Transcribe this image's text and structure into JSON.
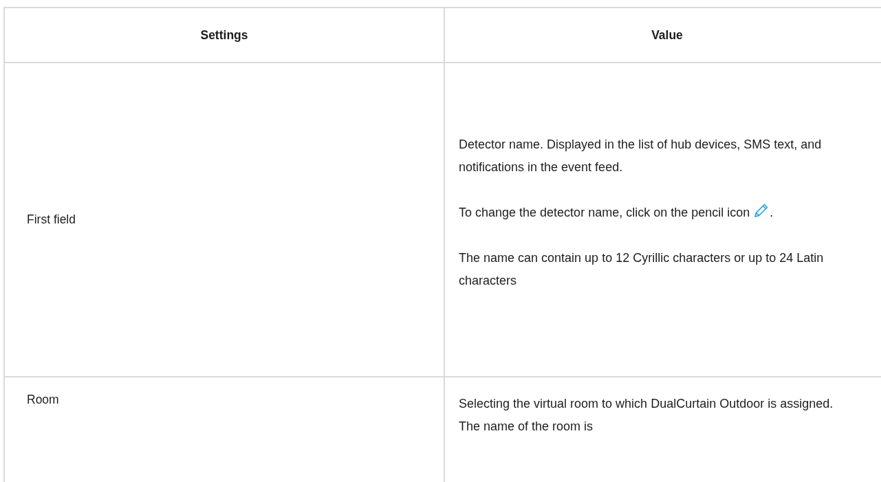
{
  "table": {
    "columns": [
      "Settings",
      "Value"
    ],
    "rows": [
      {
        "setting": "First field",
        "paragraphs": [
          {
            "text": "Detector name. Displayed in the list of hub devices, SMS text, and notifications in the event feed."
          },
          {
            "text": "To change the detector name, click on the pencil icon",
            "kind": "with_icon",
            "after": "."
          },
          {
            "text": "The name can contain up to 12 Cyrillic characters or up to 24 Latin characters"
          }
        ]
      },
      {
        "setting": "Room",
        "paragraphs": [
          {
            "text": "Selecting the virtual room to which DualCurtain Outdoor is assigned. The name of the room is"
          }
        ]
      }
    ]
  }
}
